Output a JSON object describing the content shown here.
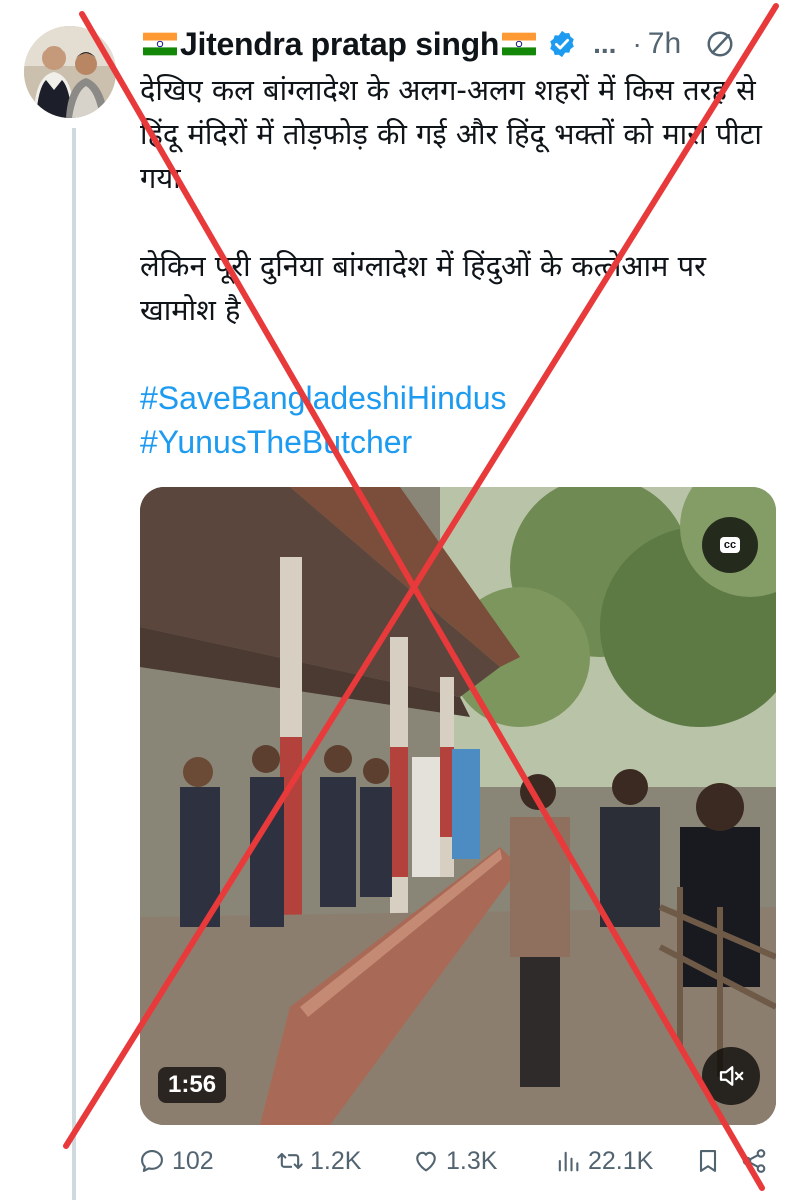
{
  "tweet": {
    "author": {
      "name": "Jitendra pratap singh",
      "name_decoration": "indian-flag-emoji",
      "verified_icon": "verified-badge-icon"
    },
    "more_label": "...",
    "separator": "·",
    "time": "7h",
    "text": {
      "paragraph1": "देखिए कल बांग्लादेश के अलग-अलग शहरों में किस तरह से हिंदू मंदिरों में तोड़फोड़ की गई और हिंदू भक्तों को मारा पीटा गया",
      "paragraph2": "लेकिन पूरी दुनिया बांग्लादेश में हिंदुओं के कत्लेआम पर खामोश है"
    },
    "hashtags": [
      "#SaveBangladeshiHindus",
      "#YunusTheButcher"
    ],
    "video": {
      "cc_label": "cc",
      "duration": "1:56",
      "mute_icon": "speaker-muted-icon"
    },
    "actions": {
      "replies": "102",
      "reposts": "1.2K",
      "likes": "1.3K",
      "views": "22.1K"
    }
  },
  "overlay": {
    "type": "red-x-cross",
    "color": "#e8393b"
  },
  "colors": {
    "link": "#1d9bf0",
    "verified": "#1d9bf0",
    "muted_text": "#536471"
  }
}
